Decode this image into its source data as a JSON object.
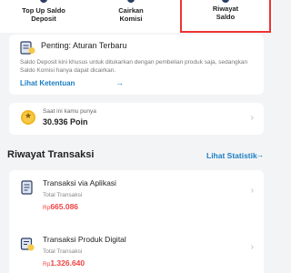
{
  "menu": {
    "items": [
      {
        "line1": "Top Up Saldo",
        "line2": "Deposit"
      },
      {
        "line1": "Cairkan",
        "line2": "Komisi"
      },
      {
        "line1": "Riwayat",
        "line2": "Saldo"
      }
    ],
    "active_index": 2,
    "icon_color": "#2c3e63",
    "highlight_color": "#e33333"
  },
  "notice": {
    "icon": "document-icon",
    "title": "Penting: Aturan Terbaru",
    "description": "Saldo Deposit kini khusus untuk ditukarkan dengan pembelian produk saja, sedangkan Saldo Komisi hanya dapat dicairkan.",
    "link": "Lihat Ketentuan",
    "link_icon": "arrow-right-icon"
  },
  "points": {
    "icon": "star-coin-icon",
    "label": "Saat ini kamu punya",
    "value": "30.936 Poin"
  },
  "history": {
    "title": "Riwayat Transaksi",
    "stats_link": "Lihat Statistik",
    "transactions": [
      {
        "icon": "app-document-icon",
        "name": "Transaksi via Aplikasi",
        "label": "Total Transaksi",
        "currency": "Rp",
        "amount": "665.086"
      },
      {
        "icon": "digital-product-icon",
        "name": "Transaksi Produk Digital",
        "label": "Total Transaksi",
        "currency": "Rp",
        "amount": "1.326.640"
      }
    ]
  },
  "colors": {
    "accent": "#1b7ec2",
    "amount": "#e44444",
    "background": "#f3f4f6"
  }
}
